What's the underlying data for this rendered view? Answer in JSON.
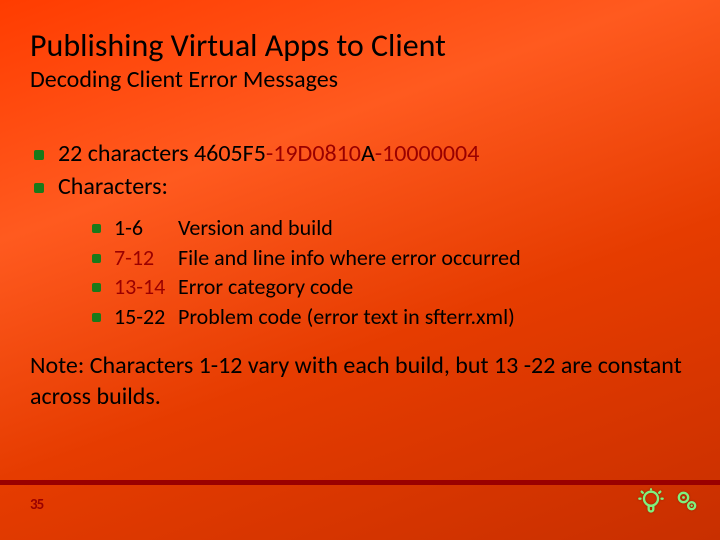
{
  "title": "Publishing Virtual Apps to Client",
  "subtitle": "Decoding Client Error Messages",
  "errorcode": {
    "prefix": "22 characters 4605F5",
    "mid_a": "-19D0810",
    "mid_b": "A",
    "suffix": "-10000004"
  },
  "characters_label": "Characters:",
  "rows": [
    {
      "range": "1-6",
      "desc": "Version and build"
    },
    {
      "range": "7-12",
      "desc": "File and line info where error occurred"
    },
    {
      "range": "13-14",
      "desc": "Error category code"
    },
    {
      "range": "15-22",
      "desc": "Problem code (error text in sfterr.xml)"
    }
  ],
  "note": "Note: Characters 1-12 vary with each build, but 13 -22 are constant across builds.",
  "page_number": "35"
}
